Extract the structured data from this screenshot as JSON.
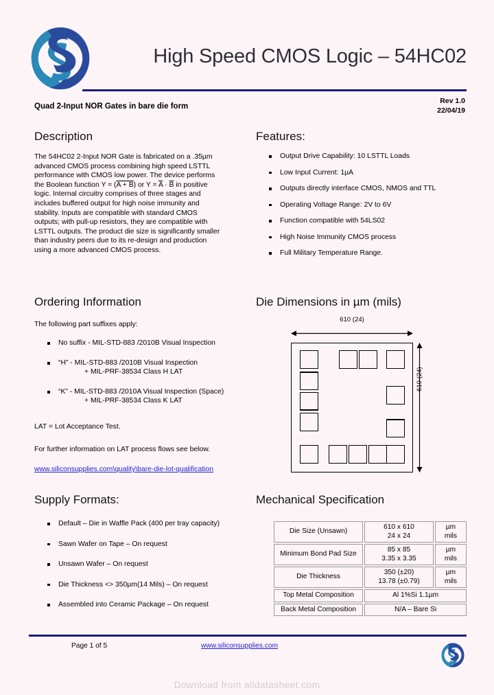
{
  "header": {
    "title": "High Speed CMOS Logic – 54HC02",
    "subtitle": "Quad 2-Input NOR Gates in bare die form",
    "rev": "Rev 1.0",
    "date": "22/04/19",
    "logo_colors": {
      "light": "#2a89b8",
      "dark": "#2a4b9b"
    },
    "rule_color": "#1a1a7a"
  },
  "description": {
    "heading": "Description",
    "lines": [
      "The 54HC02 2-Input NOR Gate is fabricated on a .35µm",
      "advanced CMOS process combining high speed LSTTL",
      "performance with CMOS low power.  The device performs",
      "BOOLEAN_LINE",
      "logic.  Internal circuitry comprises of three stages and",
      "includes buffered output for high noise immunity and",
      "stability.   Inputs are compatible with standard CMOS",
      "outputs; with pull-up resistors, they are compatible with",
      "LSTTL outputs.  The product die size is significantly smaller",
      "than industry peers due to its re-design and production",
      "using a more advanced CMOS process."
    ],
    "boolean_prefix": "the Boolean function Y = (",
    "boolean_ab": "A + B",
    "boolean_mid": ") or Y = ",
    "boolean_a": "A",
    "boolean_dot": " · ",
    "boolean_b": "B",
    "boolean_suffix": " in positive"
  },
  "features": {
    "heading": "Features:",
    "items": [
      "Output Drive Capability: 10 LSTTL Loads",
      "Low Input Current: 1µA",
      "Outputs directly interface CMOS, NMOS and TTL",
      "Operating Voltage Range: 2V to 6V",
      "Function compatible with 54LS02",
      "High Noise Immunity CMOS process",
      "Full Military Temperature Range."
    ]
  },
  "ordering": {
    "heading": "Ordering Information",
    "intro": "The following part suffixes apply:",
    "items": [
      {
        "main": "No suffix - MIL-STD-883 /2010B Visual Inspection",
        "sub": ""
      },
      {
        "main": "“H” - MIL-STD-883 /2010B  Visual Inspection",
        "sub": "+ MIL-PRF-38534 Class H LAT"
      },
      {
        "main": "“K” - MIL-STD-883 /2010A  Visual Inspection (Space)",
        "sub": "+ MIL-PRF-38534 Class K LAT"
      }
    ],
    "lat_note": "LAT = Lot Acceptance Test.",
    "further_info": "For further information on LAT process flows see below.",
    "link": "www.siliconsupplies.com\\quality\\bare-die-lot-qualification"
  },
  "die": {
    "heading": "Die Dimensions in µm (mils)",
    "width_label": "610 (24)",
    "height_label": "610 (24)"
  },
  "supply": {
    "heading": "Supply Formats:",
    "items": [
      "Default – Die in Waffle Pack (400 per tray capacity)",
      "Sawn Wafer on Tape – On request",
      "Unsawn Wafer – On request",
      "Die Thickness <> 350µm(14 Mils) – On request",
      "Assembled into Ceramic Package – On request"
    ]
  },
  "mechanical": {
    "heading": "Mechanical Specification",
    "rows": [
      {
        "label": "Die Size (Unsawn)",
        "value1": "610 x 610",
        "value2": "24 x 24",
        "unit1": "µm",
        "unit2": "mils"
      },
      {
        "label": "Minimum Bond Pad Size",
        "value1": "85 x 85",
        "value2": "3.35 x 3.35",
        "unit1": "µm",
        "unit2": "mils"
      },
      {
        "label": "Die Thickness",
        "value1": "350 (±20)",
        "value2": "13.78 (±0.79)",
        "unit1": "µm",
        "unit2": "mils"
      },
      {
        "label": "Top Metal Composition",
        "value1": "Al 1%Si 1.1µm",
        "value2": "",
        "unit1": "",
        "unit2": ""
      },
      {
        "label": "Back Metal Composition",
        "value1": "N/A – Bare Si",
        "value2": "",
        "unit1": "",
        "unit2": ""
      }
    ]
  },
  "footer": {
    "page": "Page 1 of 5",
    "link": "www.siliconsupplies.com",
    "watermark": "Download from alldatasheet.com"
  }
}
